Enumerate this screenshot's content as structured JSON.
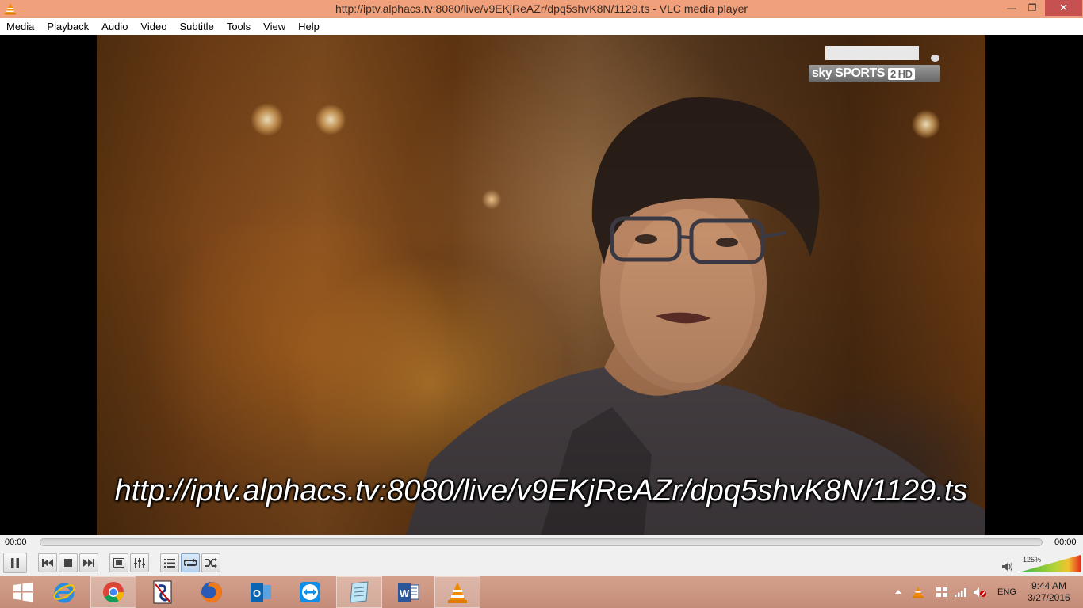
{
  "window": {
    "title": "http://iptv.alphacs.tv:8080/live/v9EKjReAZr/dpq5shvK8N/1129.ts - VLC media player",
    "min_glyph": "—",
    "max_glyph": "❐",
    "close_glyph": "✕"
  },
  "menu": [
    "Media",
    "Playback",
    "Audio",
    "Video",
    "Subtitle",
    "Tools",
    "View",
    "Help"
  ],
  "video": {
    "channel_logo_text": "sky SPORTS",
    "channel_logo_badge": "2 HD",
    "osd_text": "http://iptv.alphacs.tv:8080/live/v9EKjReAZr/dpq5shvK8N/1129.ts"
  },
  "seek": {
    "elapsed": "00:00",
    "total": "00:00"
  },
  "volume": {
    "percent_label": "125%",
    "level": 1.0
  },
  "taskbar": {
    "apps": [
      "start-icon",
      "internet-explorer-icon",
      "chrome-icon",
      "app-icon",
      "firefox-icon",
      "outlook-icon",
      "teamviewer-icon",
      "notepad-icon",
      "word-icon",
      "vlc-icon"
    ],
    "language": "ENG",
    "time": "9:44 AM",
    "date": "3/27/2016"
  }
}
